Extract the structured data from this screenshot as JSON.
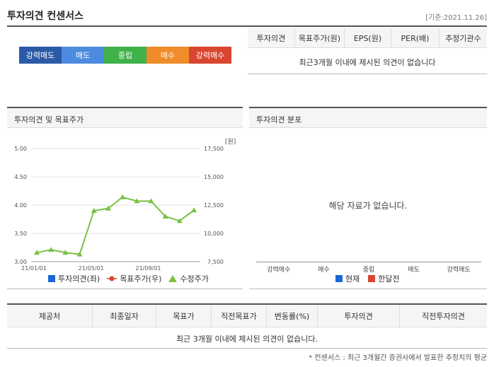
{
  "header": {
    "title": "투자의견 컨센서스",
    "date_label": "[기준:2021.11.26]"
  },
  "scale": [
    {
      "label": "강력매도",
      "color": "#2b5aa6"
    },
    {
      "label": "매도",
      "color": "#4d8be0"
    },
    {
      "label": "중립",
      "color": "#3fb24a"
    },
    {
      "label": "매수",
      "color": "#f08c2a"
    },
    {
      "label": "강력매수",
      "color": "#d9452f"
    }
  ],
  "consensus_table": {
    "columns": [
      "투자의견",
      "목표주가(원)",
      "EPS(원)",
      "PER(배)",
      "추정기관수"
    ],
    "empty_message": "최근3개월 이내에 제시된 의견이 없습니다"
  },
  "chart_panel": {
    "title": "투자의견 및 목표주가",
    "unit_label": "[원]",
    "legend": [
      {
        "label": "투자의견(좌)",
        "color": "#1a66d6",
        "icon": "square-icon"
      },
      {
        "label": "목표주가(우)",
        "color": "#d9452f",
        "icon": "dot-line-icon"
      },
      {
        "label": "수정주가",
        "color": "#7ac142",
        "icon": "triangle-icon"
      }
    ]
  },
  "chart_data": {
    "type": "line",
    "x": [
      "21/01/01",
      "",
      "",
      "",
      "21/05/01",
      "",
      "",
      "",
      "21/09/01",
      "",
      "",
      ""
    ],
    "x_tick_labels": [
      "21/01/01",
      "21/05/01",
      "21/09/01"
    ],
    "left_ticks": [
      "5.00",
      "4.50",
      "4.00",
      "3.50",
      "3.00"
    ],
    "right_ticks": [
      "17,500",
      "15,000",
      "12,500",
      "10,000",
      "7,500"
    ],
    "ylim_right": [
      7500,
      17500
    ],
    "series": [
      {
        "name": "수정주가",
        "values": [
          8300,
          8550,
          8300,
          8150,
          12000,
          12200,
          13200,
          12850,
          12850,
          11500,
          11100,
          12050
        ]
      }
    ]
  },
  "distribution_panel": {
    "title": "투자의견 분포",
    "empty_message": "해당 자료가 없습니다.",
    "categories": [
      "강력매수",
      "매수",
      "중립",
      "매도",
      "강력매도"
    ],
    "legend": [
      {
        "label": "현재",
        "color": "#1a66d6"
      },
      {
        "label": "한달전",
        "color": "#d9452f"
      }
    ]
  },
  "bottom_table": {
    "columns": [
      "제공처",
      "최종일자",
      "목표가",
      "직전목표가",
      "변동률(%)",
      "투자의견",
      "직전투자의견"
    ],
    "empty_message": "최근 3개월 이내에 제시된 의견이 없습니다."
  },
  "footnote": "* 컨센서스 : 최근 3개월간 증권사에서 발표한 추정치의 평균"
}
